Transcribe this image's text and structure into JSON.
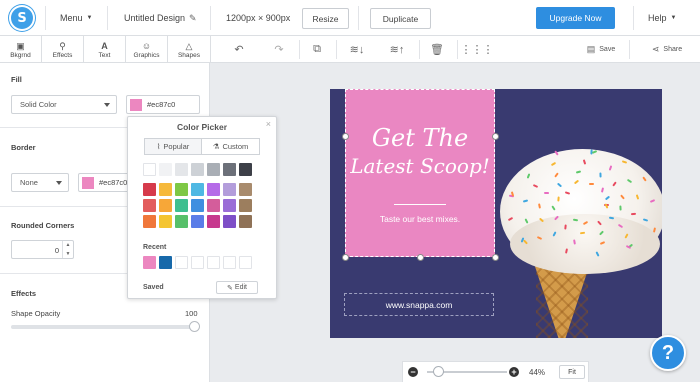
{
  "topbar": {
    "logo_letter": "S",
    "menu_label": "Menu",
    "design_title": "Untitled Design",
    "dimensions": "1200px × 900px",
    "resize_label": "Resize",
    "duplicate_label": "Duplicate",
    "upgrade_label": "Upgrade Now",
    "help_label": "Help",
    "brand_color": "#2e8ee0"
  },
  "tooltabs": [
    {
      "label": "Bkgrnd",
      "icon": "image-icon"
    },
    {
      "label": "Effects",
      "icon": "wand-icon"
    },
    {
      "label": "Text",
      "icon": "text-icon"
    },
    {
      "label": "Graphics",
      "icon": "smiley-icon"
    },
    {
      "label": "Shapes",
      "icon": "triangle-icon"
    }
  ],
  "toolbar": {
    "save_label": "Save",
    "share_label": "Share"
  },
  "leftpanel": {
    "fill_title": "Fill",
    "fill_type": "Solid Color",
    "fill_color_hex": "#ec87c0",
    "fill_color": "#ec87c0",
    "border_title": "Border",
    "border_type": "None",
    "border_color_hex": "#ec87c0",
    "rounded_title": "Rounded Corners",
    "rounded_value": "0",
    "effects_title": "Effects",
    "opacity_label": "Shape Opacity",
    "opacity_value": "100"
  },
  "picker": {
    "title": "Color Picker",
    "popular_label": "Popular",
    "custom_label": "Custom",
    "recent_label": "Recent",
    "saved_label": "Saved",
    "edit_label": "Edit",
    "popular_colors": [
      [
        "#ffffff",
        "#f1f2f4",
        "#e4e6e9",
        "#cdd1d6",
        "#a9aeb5",
        "#6c7079",
        "#3d4048"
      ],
      [
        "#d63a4b",
        "#f6b93b",
        "#7ec845",
        "#4fb8e3",
        "#b56be8",
        "#b39ddb",
        "#a88b6d"
      ],
      [
        "#e35d5d",
        "#f7a738",
        "#3fbf8f",
        "#3f8fe0",
        "#d45d9b",
        "#9a6dd7",
        "#9c7e5e"
      ],
      [
        "#f0773a",
        "#f4c531",
        "#57c06a",
        "#5a7de8",
        "#c7398e",
        "#7e4fc7",
        "#8f7257"
      ]
    ],
    "recent_colors": [
      "#ec87c0",
      "#1769aa"
    ]
  },
  "design": {
    "headline_line1": "Get The",
    "headline_line2": "Latest Scoop!",
    "subtitle": "Taste our best mixes.",
    "url_text": "www.snappa.com",
    "background_color": "#393a70",
    "box_color": "#ea87c2"
  },
  "zoom": {
    "percent": "44%",
    "fit_label": "Fit",
    "minus": "−",
    "plus": "+"
  },
  "help_bubble": "?"
}
